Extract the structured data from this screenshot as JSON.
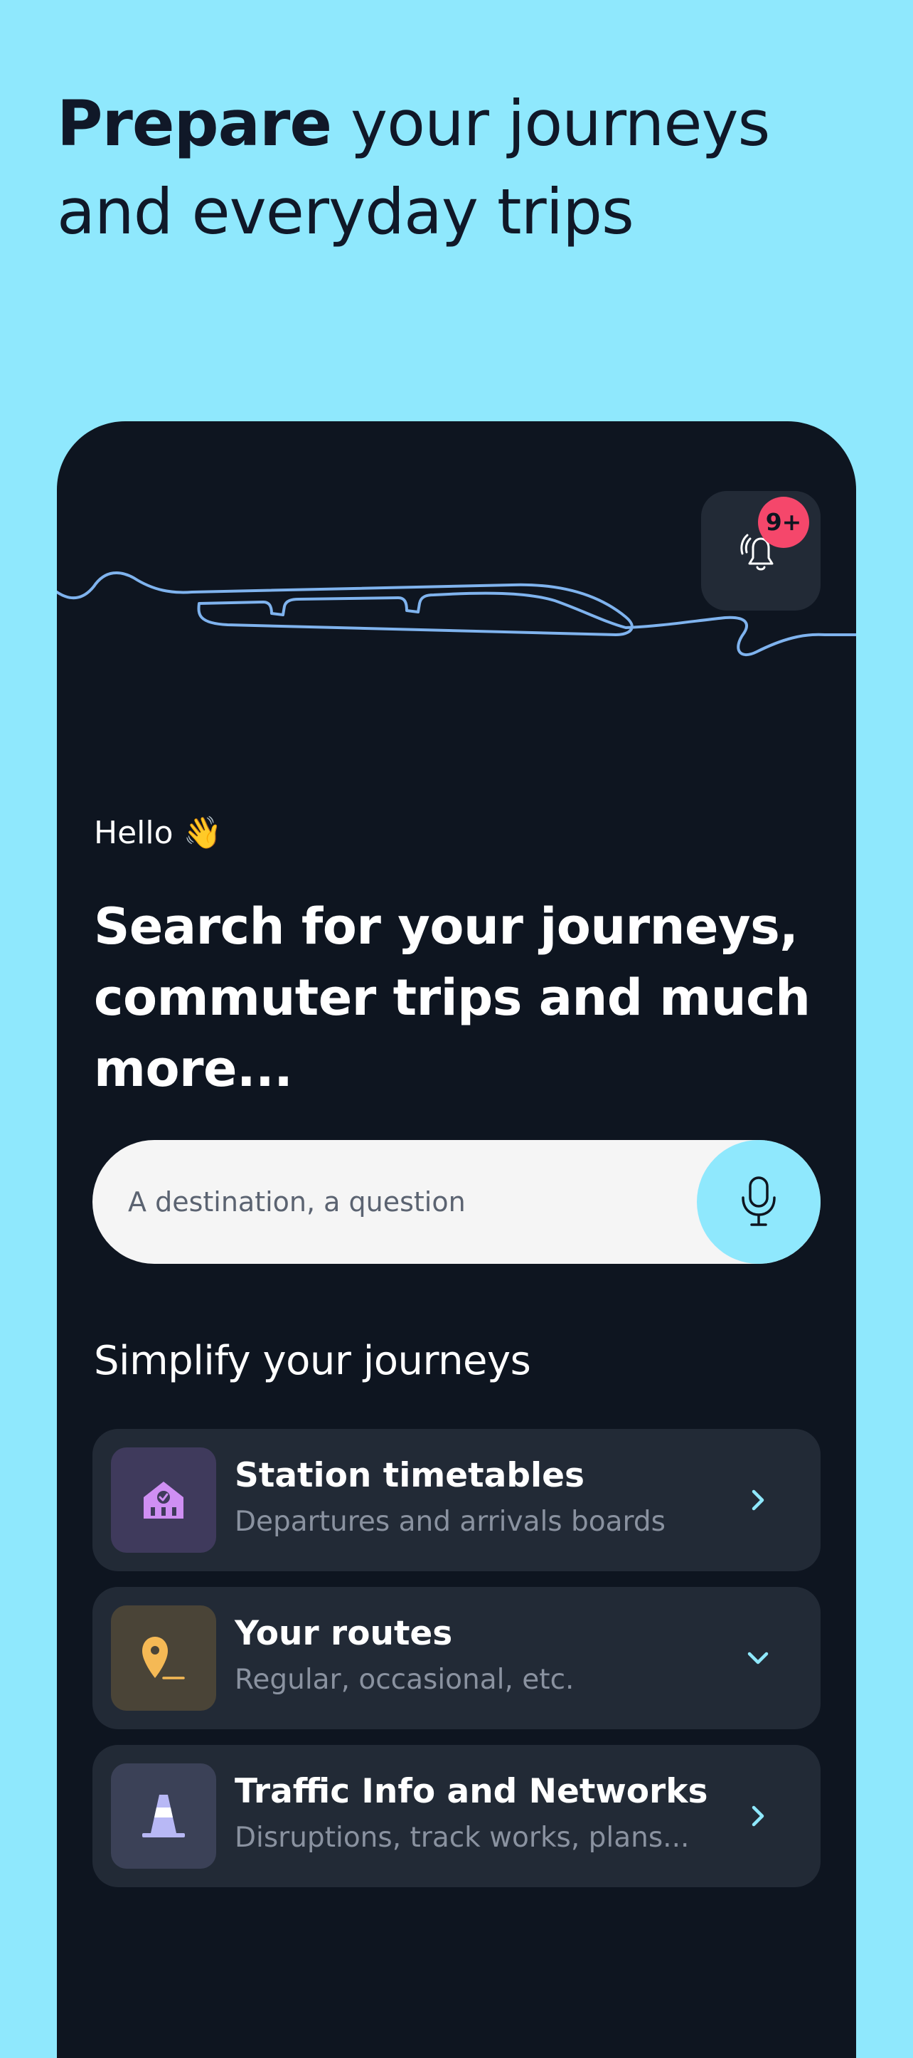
{
  "headline": {
    "bold": "Prepare",
    "rest": " your journeys and everyday trips"
  },
  "notifications": {
    "icon": "bell-icon",
    "badge": "9+",
    "badge_color": "#f5476b"
  },
  "greeting": "Hello 👋",
  "hero_title": "Search for your journeys, commuter trips and much more...",
  "search": {
    "placeholder": "A destination, a question",
    "mic_icon": "microphone-icon"
  },
  "section_title": "Simplify your journeys",
  "cards": [
    {
      "title": "Station timetables",
      "subtitle": "Departures and arrivals boards",
      "icon": "station-icon",
      "chevron": "chevron-right-icon",
      "tile_color": "#3f3a5c",
      "icon_color": "#cf8ff3"
    },
    {
      "title": "Your routes",
      "subtitle": "Regular, occasional, etc.",
      "icon": "location-pin-icon",
      "chevron": "chevron-down-icon",
      "tile_color": "#4a4437",
      "icon_color": "#f5b955"
    },
    {
      "title": "Traffic Info and Networks",
      "subtitle": "Disruptions, track works, plans...",
      "icon": "traffic-cone-icon",
      "chevron": "chevron-right-icon",
      "tile_color": "#3b4157",
      "icon_color": "#b8b8f5"
    }
  ],
  "colors": {
    "background": "#8fe8fd",
    "panel": "#0e1520",
    "card": "#222a36",
    "accent": "#8fe8fd",
    "train_line": "#7fb3ee"
  }
}
